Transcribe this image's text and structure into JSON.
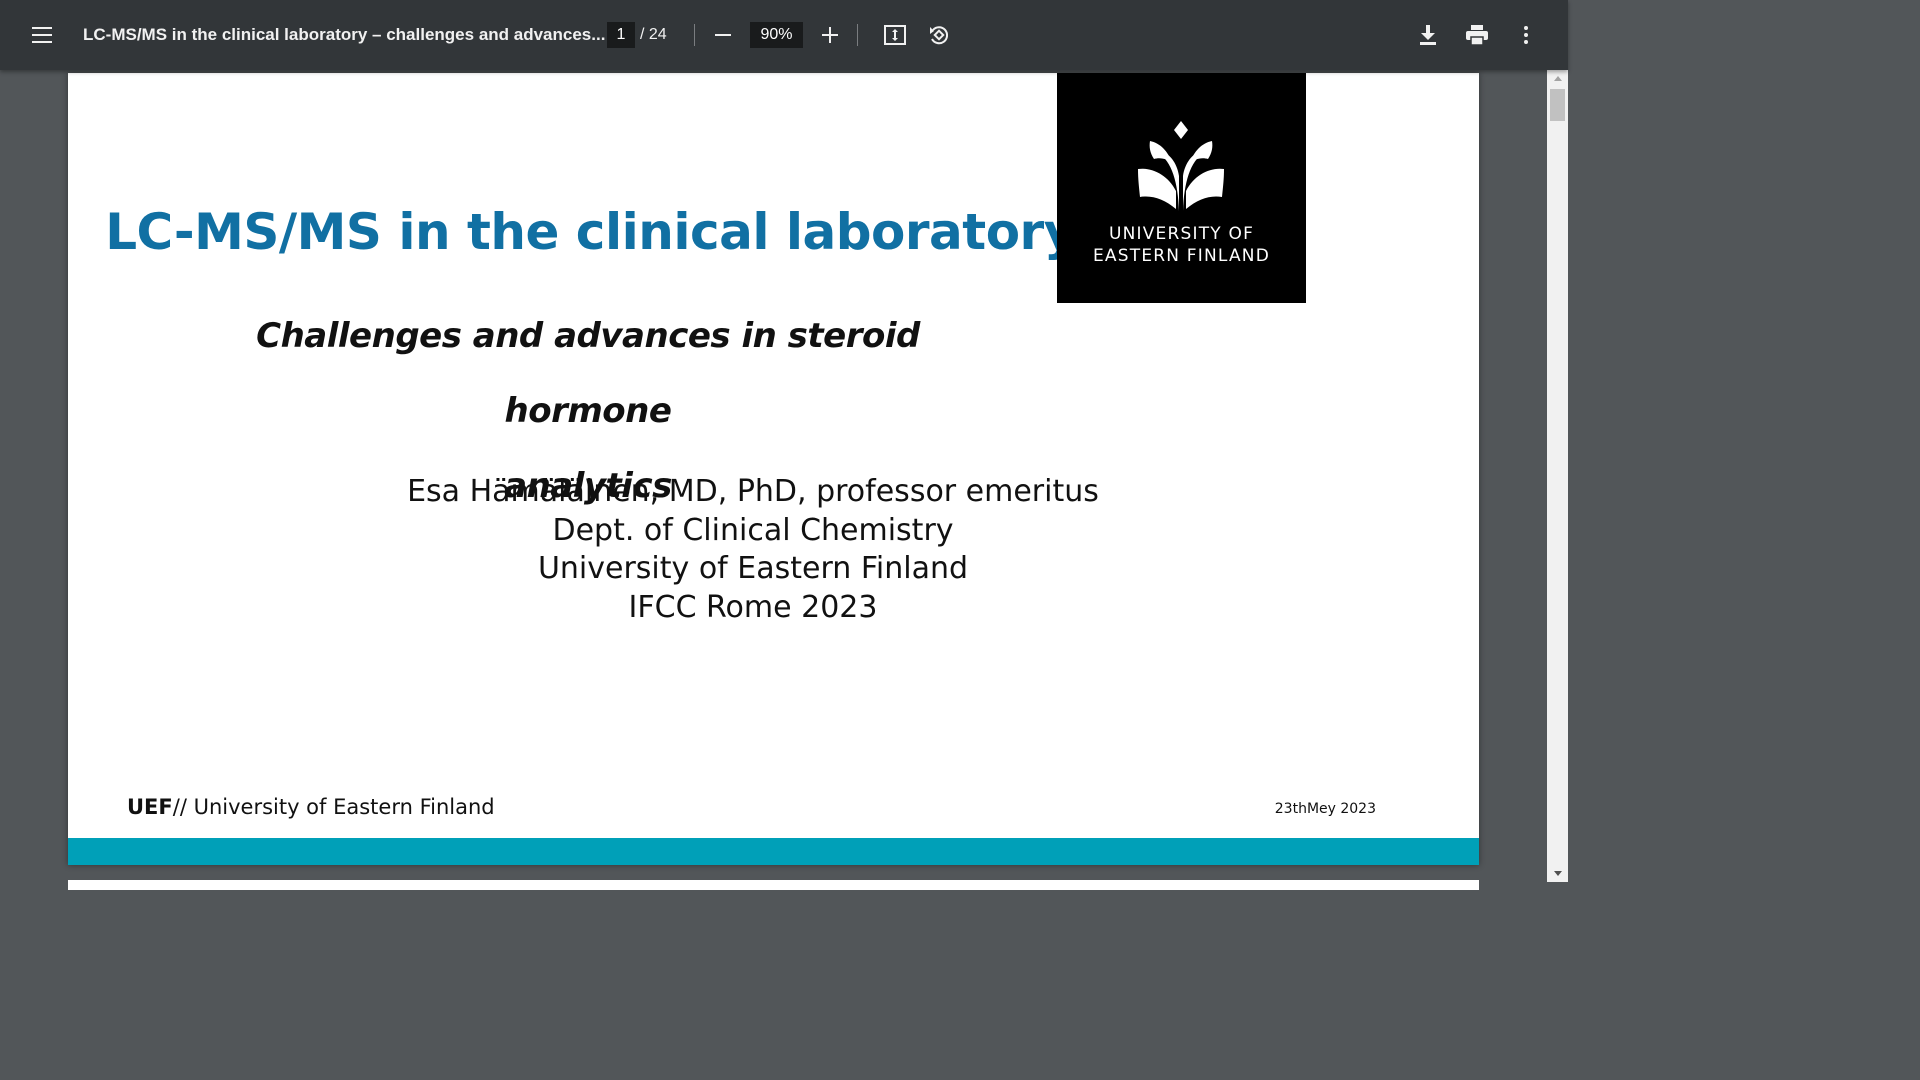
{
  "toolbar": {
    "menu_icon": "hamburger-menu-icon",
    "title": "LC-MS/MS in the clinical laboratory – challenges and advances...",
    "page_current": "1",
    "page_total": "/ 24",
    "zoom": "90%",
    "icons": {
      "zoom_out": "minus-icon",
      "zoom_in": "plus-icon",
      "fit": "fit-to-page-icon",
      "rotate": "rotate-icon",
      "download": "download-icon",
      "print": "print-icon",
      "more": "more-vertical-icon"
    },
    "background": "#323639"
  },
  "slide": {
    "title": "LC-MS/MS in the clinical laboratory",
    "subtitle_line1": "Challenges and advances in steroid hormone",
    "subtitle_line2": "analytics",
    "author_lines": [
      "Esa Hämäläinen, MD, PhD, professor emeritus",
      "Dept. of Clinical Chemistry",
      "University of Eastern Finland",
      "IFCC Rome 2023"
    ],
    "logo": {
      "line1": "UNIVERSITY OF",
      "line2": "EASTERN FINLAND"
    },
    "footer": {
      "brand": "UEF",
      "brand_rest": "// University of Eastern Finland",
      "date": "23thMey 2023"
    },
    "colors": {
      "title": "#1170a3",
      "band": "#00a0b8"
    }
  }
}
